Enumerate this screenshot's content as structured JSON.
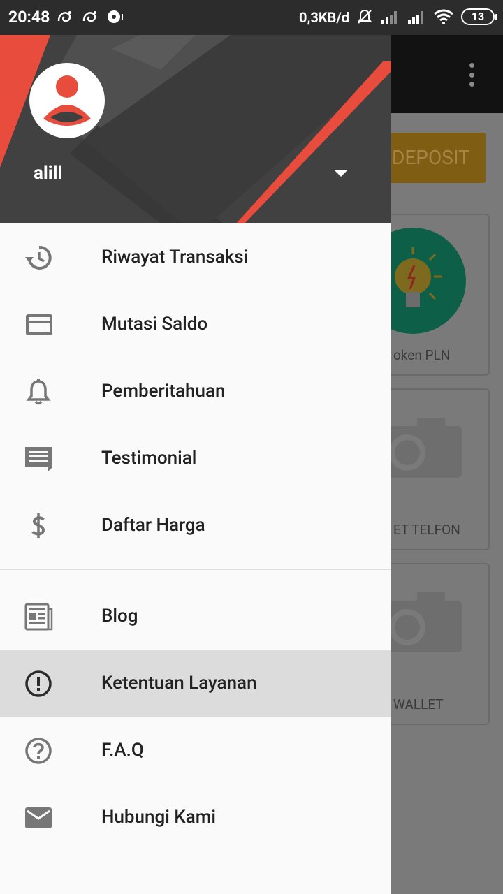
{
  "status_bar": {
    "time": "20:48",
    "network_rate": "0,3KB/d",
    "battery": "13"
  },
  "drawer": {
    "user_name": "alill",
    "menu_primary": [
      {
        "label": "Riwayat Transaksi",
        "icon": "history-icon"
      },
      {
        "label": "Mutasi Saldo",
        "icon": "credit-card-icon"
      },
      {
        "label": "Pemberitahuan",
        "icon": "bell-icon"
      },
      {
        "label": "Testimonial",
        "icon": "chat-icon"
      },
      {
        "label": "Daftar Harga",
        "icon": "dollar-icon"
      }
    ],
    "menu_secondary": [
      {
        "label": "Blog",
        "icon": "newspaper-icon"
      },
      {
        "label": "Ketentuan Layanan",
        "icon": "alert-circle-icon",
        "selected": true
      },
      {
        "label": "F.A.Q",
        "icon": "help-circle-icon"
      },
      {
        "label": "Hubungi Kami",
        "icon": "mail-icon"
      }
    ]
  },
  "background_app": {
    "deposit_label": "DEPOSIT",
    "cards": [
      {
        "label": "oken PLN"
      },
      {
        "label": "ET TELFON"
      },
      {
        "label": "WALLET"
      }
    ]
  },
  "colors": {
    "accent_red": "#e74c3c",
    "header_gray": "#3f3f3f",
    "selected_item": "#dcdcdc",
    "deposit_orange": "#7f5d12"
  }
}
